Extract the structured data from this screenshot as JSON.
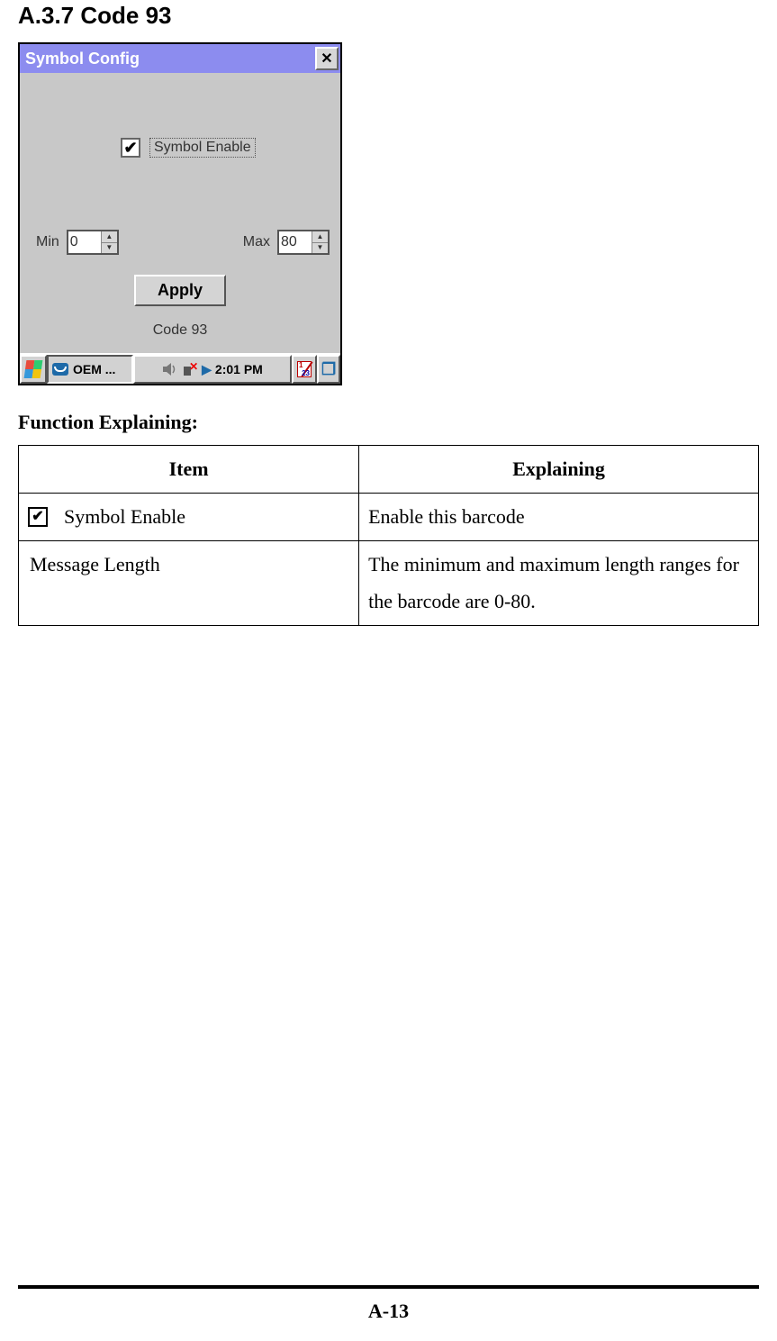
{
  "section_heading": "A.3.7 Code 93",
  "dialog": {
    "title": "Symbol Config",
    "close_glyph": "✕",
    "checkbox_checked_glyph": "✔",
    "enable_label": "Symbol Enable",
    "min_label": "Min",
    "min_value": "0",
    "max_label": "Max",
    "max_value": "80",
    "apply_label": "Apply",
    "caption": "Code 93"
  },
  "taskbar": {
    "oem_label": "OEM ...",
    "clock": "2:01 PM"
  },
  "func_heading": "Function Explaining:",
  "table": {
    "headers": {
      "item": "Item",
      "explaining": "Explaining"
    },
    "rows": [
      {
        "has_checkbox": true,
        "item": "Symbol Enable",
        "explaining": "Enable this barcode"
      },
      {
        "has_checkbox": false,
        "item": "Message Length",
        "explaining": "The minimum and maximum length ranges for the barcode are 0-80."
      }
    ]
  },
  "page_number": "A-13"
}
